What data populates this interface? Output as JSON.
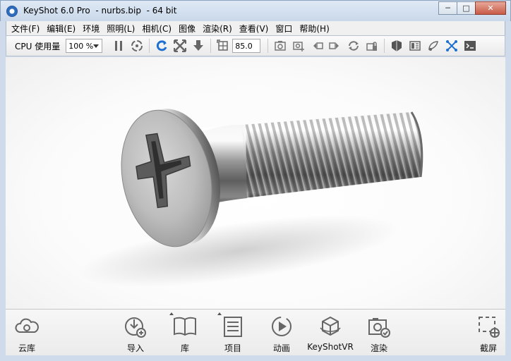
{
  "window": {
    "title": "KeyShot 6.0 Pro  - nurbs.bip  - 64 bit",
    "minimize": "─",
    "maximize": "□",
    "close": "✕"
  },
  "menu": [
    "文件(F)",
    "编辑(E)",
    "环境",
    "照明(L)",
    "相机(C)",
    "图像",
    "渲染(R)",
    "查看(V)",
    "窗口",
    "帮助(H)"
  ],
  "toolbar": {
    "cpu_label": "CPU 使用量",
    "cpu_value": "100 %",
    "resolution_value": "85.0",
    "icons": [
      "pause-icon",
      "render-mode-icon",
      "refresh-icon",
      "fit-view-icon",
      "import-arrow-icon",
      "region-icon",
      "screenshot-icon",
      "screenshot-add-icon",
      "prev-view-icon",
      "next-view-icon",
      "rotate-icon",
      "lock-camera-icon",
      "material-icon",
      "panel-icon",
      "paint-icon",
      "geometry-icon",
      "console-icon"
    ]
  },
  "bottombar": {
    "cloud": "云库",
    "import": "导入",
    "library": "库",
    "project": "项目",
    "animation": "动画",
    "vr": "KeyShotVR",
    "render": "渲染",
    "screenshot": "截屏"
  },
  "colors": {
    "accent_blue": "#1f6fd1",
    "icon_gray": "#666666"
  }
}
